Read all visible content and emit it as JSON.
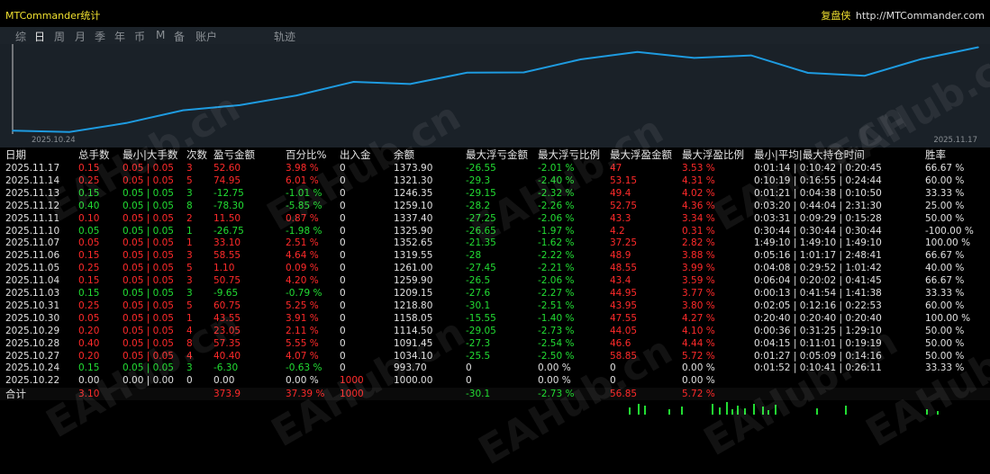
{
  "app_title": "MTCommander统计",
  "brand": {
    "name": "复盘侠",
    "url": "http://MTCommander.com"
  },
  "tabs": [
    "综",
    "日",
    "周",
    "月",
    "季",
    "年",
    "币",
    "M",
    "备",
    "账户",
    "轨迹"
  ],
  "active_tab": 1,
  "watermark": "EAHub.cn",
  "chart_data": {
    "type": "line",
    "x_start_label": "2025.10.24",
    "x_end_label": "2025.11.17",
    "x": [
      "2025.10.22",
      "2025.10.24",
      "2025.10.27",
      "2025.10.28",
      "2025.10.29",
      "2025.10.30",
      "2025.10.31",
      "2025.11.03",
      "2025.11.04",
      "2025.11.05",
      "2025.11.06",
      "2025.11.07",
      "2025.11.10",
      "2025.11.11",
      "2025.11.12",
      "2025.11.13",
      "2025.11.14",
      "2025.11.17"
    ],
    "values": [
      1000.0,
      993.7,
      1034.1,
      1091.45,
      1114.5,
      1158.05,
      1218.8,
      1209.15,
      1259.9,
      1261.0,
      1319.55,
      1352.65,
      1325.9,
      1337.4,
      1259.1,
      1246.35,
      1321.3,
      1373.9
    ],
    "line_color": "#1e9be0",
    "ylim": [
      985,
      1380
    ]
  },
  "table": {
    "headers": [
      "日期",
      "总手数",
      "最小|大手数",
      "次数",
      "盈亏金额",
      "百分比%",
      "出入金",
      "余额",
      "最大浮亏金额",
      "最大浮亏比例",
      "最大浮盈金额",
      "最大浮盈比例",
      "最小|平均|最大持仓时间",
      "胜率"
    ],
    "rows": [
      [
        "2025.11.17",
        "0.15",
        "0.05 | 0.05",
        "3",
        "52.60",
        "3.98 %",
        "0",
        "1373.90",
        "-26.55",
        "-2.01 %",
        "47",
        "3.53 %",
        "0:01:14 | 0:10:42 | 0:20:45",
        "66.67 %"
      ],
      [
        "2025.11.14",
        "0.25",
        "0.05 | 0.05",
        "5",
        "74.95",
        "6.01 %",
        "0",
        "1321.30",
        "-29.3",
        "-2.40 %",
        "53.15",
        "4.31 %",
        "0:10:19 | 0:16:55 | 0:24:44",
        "60.00 %"
      ],
      [
        "2025.11.13",
        "0.15",
        "0.05 | 0.05",
        "3",
        "-12.75",
        "-1.01 %",
        "0",
        "1246.35",
        "-29.15",
        "-2.32 %",
        "49.4",
        "4.02 %",
        "0:01:21 | 0:04:38 | 0:10:50",
        "33.33 %"
      ],
      [
        "2025.11.12",
        "0.40",
        "0.05 | 0.05",
        "8",
        "-78.30",
        "-5.85 %",
        "0",
        "1259.10",
        "-28.2",
        "-2.26 %",
        "52.75",
        "4.36 %",
        "0:03:20 | 0:44:04 | 2:31:30",
        "25.00 %"
      ],
      [
        "2025.11.11",
        "0.10",
        "0.05 | 0.05",
        "2",
        "11.50",
        "0.87 %",
        "0",
        "1337.40",
        "-27.25",
        "-2.06 %",
        "43.3",
        "3.34 %",
        "0:03:31 | 0:09:29 | 0:15:28",
        "50.00 %"
      ],
      [
        "2025.11.10",
        "0.05",
        "0.05 | 0.05",
        "1",
        "-26.75",
        "-1.98 %",
        "0",
        "1325.90",
        "-26.65",
        "-1.97 %",
        "4.2",
        "0.31 %",
        "0:30:44 | 0:30:44 | 0:30:44",
        "-100.00 %"
      ],
      [
        "2025.11.07",
        "0.05",
        "0.05 | 0.05",
        "1",
        "33.10",
        "2.51 %",
        "0",
        "1352.65",
        "-21.35",
        "-1.62 %",
        "37.25",
        "2.82 %",
        "1:49:10 | 1:49:10 | 1:49:10",
        "100.00 %"
      ],
      [
        "2025.11.06",
        "0.15",
        "0.05 | 0.05",
        "3",
        "58.55",
        "4.64 %",
        "0",
        "1319.55",
        "-28",
        "-2.22 %",
        "48.9",
        "3.88 %",
        "0:05:16 | 1:01:17 | 2:48:41",
        "66.67 %"
      ],
      [
        "2025.11.05",
        "0.25",
        "0.05 | 0.05",
        "5",
        "1.10",
        "0.09 %",
        "0",
        "1261.00",
        "-27.45",
        "-2.21 %",
        "48.55",
        "3.99 %",
        "0:04:08 | 0:29:52 | 1:01:42",
        "40.00 %"
      ],
      [
        "2025.11.04",
        "0.15",
        "0.05 | 0.05",
        "3",
        "50.75",
        "4.20 %",
        "0",
        "1259.90",
        "-26.5",
        "-2.06 %",
        "43.4",
        "3.59 %",
        "0:06:04 | 0:20:02 | 0:41:45",
        "66.67 %"
      ],
      [
        "2025.11.03",
        "0.15",
        "0.05 | 0.05",
        "3",
        "-9.65",
        "-0.79 %",
        "0",
        "1209.15",
        "-27.6",
        "-2.27 %",
        "44.95",
        "3.77 %",
        "0:00:13 | 0:41:54 | 1:41:38",
        "33.33 %"
      ],
      [
        "2025.10.31",
        "0.25",
        "0.05 | 0.05",
        "5",
        "60.75",
        "5.25 %",
        "0",
        "1218.80",
        "-30.1",
        "-2.51 %",
        "43.95",
        "3.80 %",
        "0:02:05 | 0:12:16 | 0:22:53",
        "60.00 %"
      ],
      [
        "2025.10.30",
        "0.05",
        "0.05 | 0.05",
        "1",
        "43.55",
        "3.91 %",
        "0",
        "1158.05",
        "-15.55",
        "-1.40 %",
        "47.55",
        "4.27 %",
        "0:20:40 | 0:20:40 | 0:20:40",
        "100.00 %"
      ],
      [
        "2025.10.29",
        "0.20",
        "0.05 | 0.05",
        "4",
        "23.05",
        "2.11 %",
        "0",
        "1114.50",
        "-29.05",
        "-2.73 %",
        "44.05",
        "4.10 %",
        "0:00:36 | 0:31:25 | 1:29:10",
        "50.00 %"
      ],
      [
        "2025.10.28",
        "0.40",
        "0.05 | 0.05",
        "8",
        "57.35",
        "5.55 %",
        "0",
        "1091.45",
        "-27.3",
        "-2.54 %",
        "46.6",
        "4.44 %",
        "0:04:15 | 0:11:01 | 0:19:19",
        "50.00 %"
      ],
      [
        "2025.10.27",
        "0.20",
        "0.05 | 0.05",
        "4",
        "40.40",
        "4.07 %",
        "0",
        "1034.10",
        "-25.5",
        "-2.50 %",
        "58.85",
        "5.72 %",
        "0:01:27 | 0:05:09 | 0:14:16",
        "50.00 %"
      ],
      [
        "2025.10.24",
        "0.15",
        "0.05 | 0.05",
        "3",
        "-6.30",
        "-0.63 %",
        "0",
        "993.70",
        "0",
        "0.00 %",
        "0",
        "0.00 %",
        "0:01:52 | 0:10:41 | 0:26:11",
        "33.33 %"
      ],
      [
        "2025.10.22",
        "0.00",
        "0.00 | 0.00",
        "0",
        "0.00",
        "0.00 %",
        "1000",
        "1000.00",
        "0",
        "0.00 %",
        "0",
        "0.00 %",
        "",
        ""
      ]
    ],
    "total": [
      "合计",
      "3.10",
      "",
      "",
      "373.9",
      "37.39 %",
      "1000",
      "",
      "-30.1",
      "-2.73 %",
      "56.85",
      "5.72 %",
      "",
      ""
    ]
  },
  "colors": {
    "loss_red": "#ff2a2a",
    "profit_green": "#22dd33",
    "title_yellow": "#f0e030",
    "chart_bg": "#1a2128",
    "tab_bg": "#1c232a"
  }
}
